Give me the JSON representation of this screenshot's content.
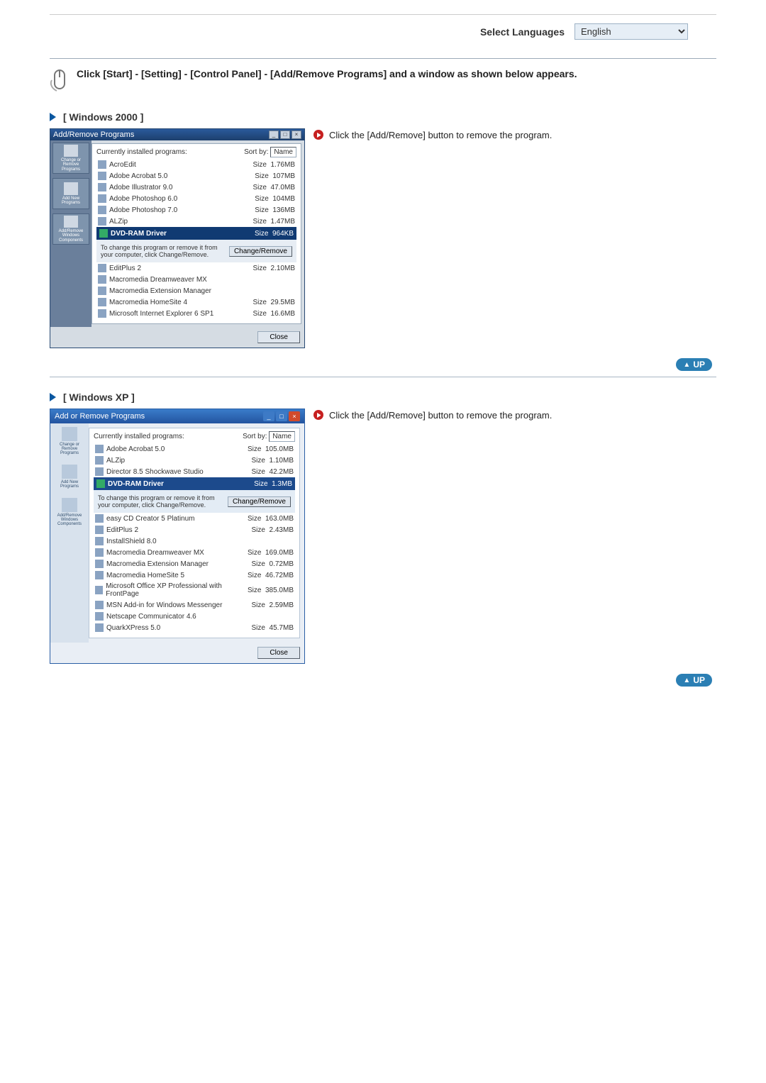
{
  "lang": {
    "label": "Select Languages",
    "selected": "English"
  },
  "intro": "Click [Start] - [Setting] - [Control Panel] - [Add/Remove Programs] and a window as shown below appears.",
  "section_a": "[  Windows 2000  ]",
  "section_b": "[  Windows XP  ]",
  "rhs_tip": "Click the [Add/Remove] button to remove the program.",
  "up_label": "UP",
  "win2000": {
    "title": "Add/Remove Programs",
    "sidebar": [
      "Change or Remove Programs",
      "Add New Programs",
      "Add/Remove Windows Components"
    ],
    "currently_label": "Currently installed programs:",
    "sort_label": "Sort by:",
    "sort_value": "Name",
    "cols": {
      "size": "Size"
    },
    "programs": [
      {
        "name": "AcroEdit",
        "size": "1.76MB"
      },
      {
        "name": "Adobe Acrobat 5.0",
        "size": "107MB"
      },
      {
        "name": "Adobe Illustrator 9.0",
        "size": "47.0MB"
      },
      {
        "name": "Adobe Photoshop 6.0",
        "size": "104MB"
      },
      {
        "name": "Adobe Photoshop 7.0",
        "size": "136MB"
      },
      {
        "name": "ALZip",
        "size": "1.47MB"
      }
    ],
    "selected": {
      "name": "DVD-RAM Driver",
      "size": "964KB"
    },
    "change_hint": "To change this program or remove it from your computer, click Change/Remove.",
    "change_btn": "Change/Remove",
    "more": [
      {
        "name": "EditPlus 2",
        "size": "2.10MB"
      },
      {
        "name": "Macromedia Dreamweaver MX",
        "size": ""
      },
      {
        "name": "Macromedia Extension Manager",
        "size": ""
      },
      {
        "name": "Macromedia HomeSite 4",
        "size": "29.5MB"
      },
      {
        "name": "Microsoft Internet Explorer 6 SP1",
        "size": "16.6MB"
      }
    ],
    "close": "Close"
  },
  "winxp": {
    "title": "Add or Remove Programs",
    "sidebar": [
      "Change or Remove Programs",
      "Add New Programs",
      "Add/Remove Windows Components"
    ],
    "currently_label": "Currently installed programs:",
    "sort_label": "Sort by:",
    "sort_value": "Name",
    "programs": [
      {
        "name": "Adobe Acrobat 5.0",
        "size": "105.0MB"
      },
      {
        "name": "ALZip",
        "size": "1.10MB"
      },
      {
        "name": "Director 8.5 Shockwave Studio",
        "size": "42.2MB"
      }
    ],
    "selected": {
      "name": "DVD-RAM Driver",
      "size": "1.3MB"
    },
    "change_hint": "To change this program or remove it from your computer, click Change/Remove.",
    "change_btn": "Change/Remove",
    "more": [
      {
        "name": "easy CD Creator 5 Platinum",
        "size": "163.0MB"
      },
      {
        "name": "EditPlus 2",
        "size": "2.43MB"
      },
      {
        "name": "InstallShield 8.0",
        "size": ""
      },
      {
        "name": "Macromedia Dreamweaver MX",
        "size": "169.0MB"
      },
      {
        "name": "Macromedia Extension Manager",
        "size": "0.72MB"
      },
      {
        "name": "Macromedia HomeSite 5",
        "size": "46.72MB"
      },
      {
        "name": "Microsoft Office XP Professional with FrontPage",
        "size": "385.0MB"
      },
      {
        "name": "MSN Add-in for Windows Messenger",
        "size": "2.59MB"
      },
      {
        "name": "Netscape Communicator 4.6",
        "size": ""
      },
      {
        "name": "QuarkXPress 5.0",
        "size": "45.7MB"
      }
    ],
    "close": "Close"
  }
}
